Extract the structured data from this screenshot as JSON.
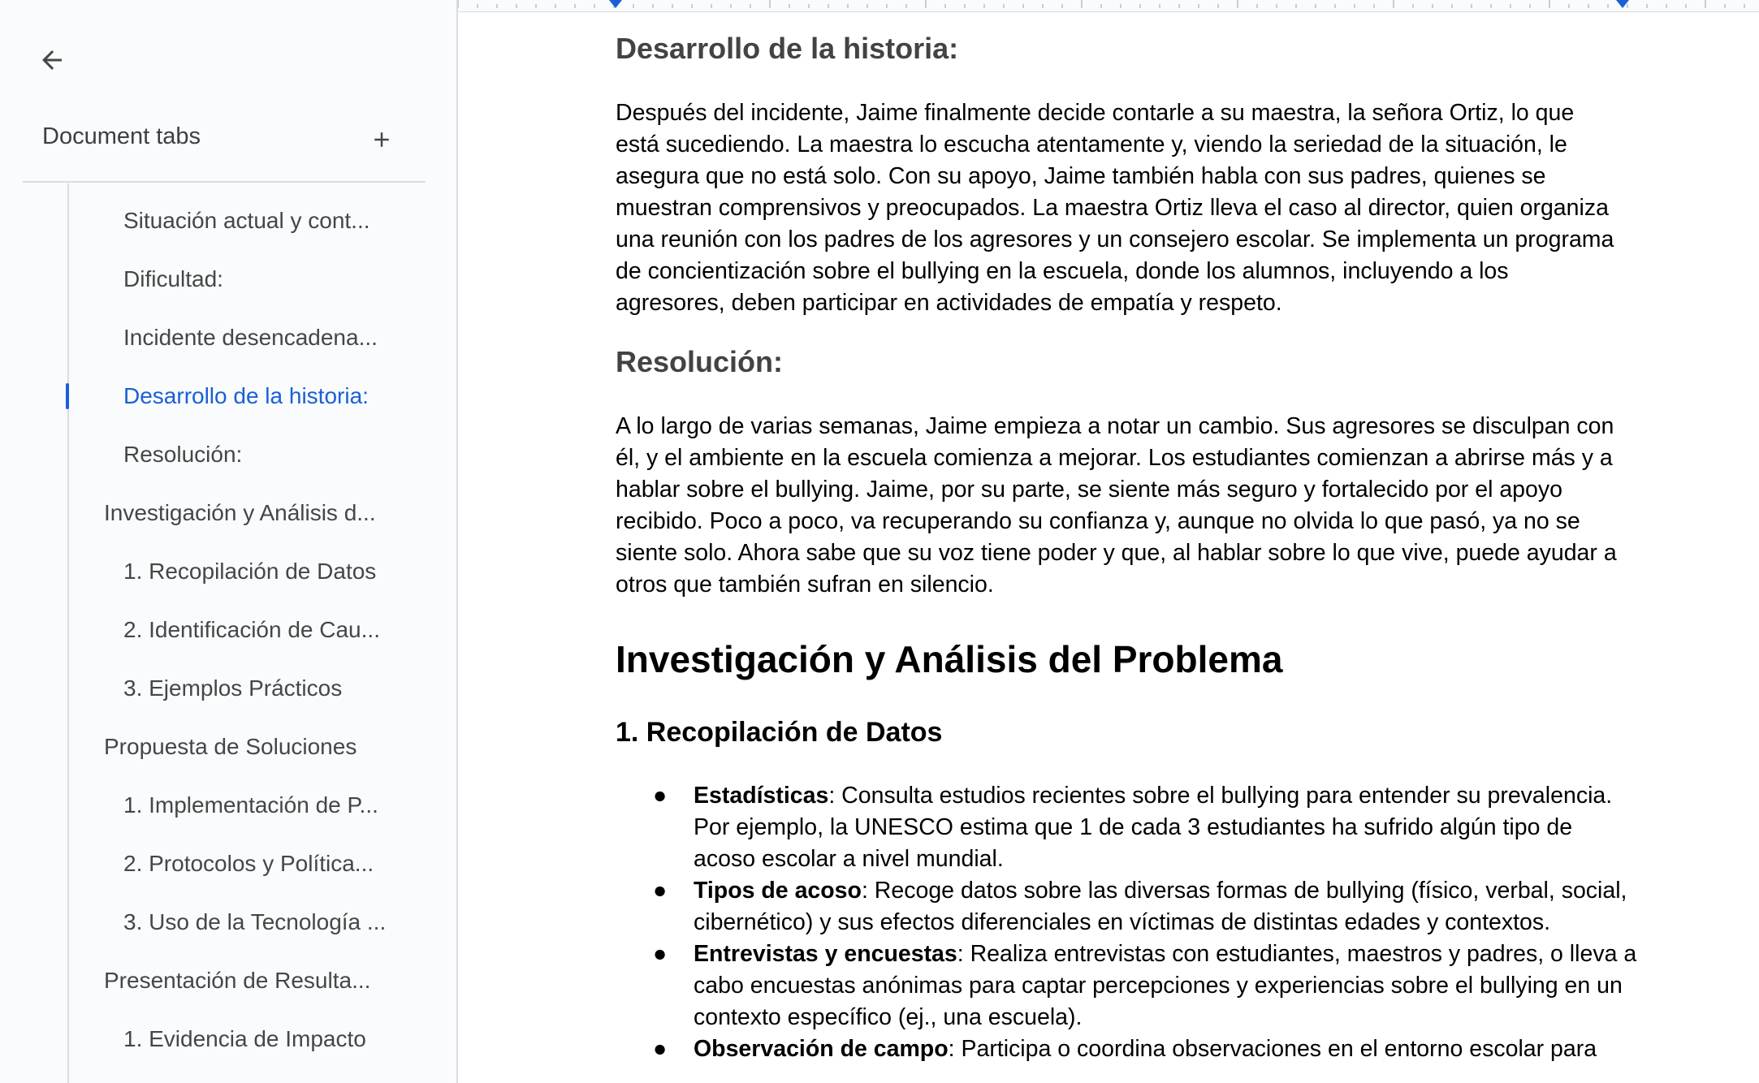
{
  "sidebar": {
    "header": "Document tabs",
    "items": [
      {
        "label": "Situación actual y cont...",
        "level": 2,
        "active": false
      },
      {
        "label": "Dificultad:",
        "level": 2,
        "active": false
      },
      {
        "label": "Incidente desencadena...",
        "level": 2,
        "active": false
      },
      {
        "label": "Desarrollo de la historia:",
        "level": 2,
        "active": true
      },
      {
        "label": "Resolución:",
        "level": 2,
        "active": false
      },
      {
        "label": "Investigación y Análisis d...",
        "level": 1,
        "active": false
      },
      {
        "label": "1. Recopilación de Datos",
        "level": 2,
        "active": false
      },
      {
        "label": "2. Identificación de Cau...",
        "level": 2,
        "active": false
      },
      {
        "label": "3. Ejemplos Prácticos",
        "level": 2,
        "active": false
      },
      {
        "label": "Propuesta de Soluciones",
        "level": 1,
        "active": false
      },
      {
        "label": "1. Implementación de P...",
        "level": 2,
        "active": false
      },
      {
        "label": "2. Protocolos y Política...",
        "level": 2,
        "active": false
      },
      {
        "label": "3. Uso de la Tecnología ...",
        "level": 2,
        "active": false
      },
      {
        "label": "Presentación de Resulta...",
        "level": 1,
        "active": false
      },
      {
        "label": "1. Evidencia de Impacto",
        "level": 2,
        "active": false
      }
    ],
    "back_icon": "arrow-left-icon",
    "add_icon": "plus-icon"
  },
  "document": {
    "h_desarrollo": "Desarrollo de la historia:",
    "p_desarrollo": "Después del incidente, Jaime finalmente decide contarle a su maestra, la señora Ortiz, lo que está sucediendo. La maestra lo escucha atentamente y, viendo la seriedad de la situación, le asegura que no está solo. Con su apoyo, Jaime también habla con sus padres, quienes se muestran comprensivos y preocupados. La maestra Ortiz lleva el caso al director, quien organiza una reunión con los padres de los agresores y un consejero escolar. Se implementa un programa de concientización sobre el bullying en la escuela, donde los alumnos, incluyendo a los agresores, deben participar en actividades de empatía y respeto.",
    "h_resolucion": "Resolución:",
    "p_resolucion": "A lo largo de varias semanas, Jaime empieza a notar un cambio. Sus agresores se disculpan con él, y el ambiente en la escuela comienza a mejorar. Los estudiantes comienzan a abrirse más y a hablar sobre el bullying. Jaime, por su parte, se siente más seguro y fortalecido por el apoyo recibido. Poco a poco, va recuperando su confianza y, aunque no olvida lo que pasó, ya no se siente solo. Ahora sabe que su voz tiene poder y que, al hablar sobre lo que vive, puede ayudar a otros que también sufran en silencio.",
    "h1_investigacion": "Investigación y Análisis del Problema",
    "h2_recopilacion": "1. Recopilación de Datos",
    "bullets": [
      {
        "term": "Estadísticas",
        "text": ": Consulta estudios recientes sobre el bullying para entender su prevalencia. Por ejemplo, la UNESCO estima que 1 de cada 3 estudiantes ha sufrido algún tipo de acoso escolar a nivel mundial."
      },
      {
        "term": "Tipos de acoso",
        "text": ": Recoge datos sobre las diversas formas de bullying (físico, verbal, social, cibernético) y sus efectos diferenciales en víctimas de distintas edades y contextos."
      },
      {
        "term": "Entrevistas y encuestas",
        "text": ": Realiza entrevistas con estudiantes, maestros y padres, o lleva a cabo encuestas anónimas para captar percepciones y experiencias sobre el bullying en un contexto específico (ej., una escuela)."
      },
      {
        "term": "Observación de campo",
        "text": ": Participa o coordina observaciones en el entorno escolar para"
      }
    ],
    "bullet_char": "●"
  },
  "colors": {
    "accent": "#1a5fd6",
    "sidebar_bg": "#f9fbfd",
    "text_gray": "#444746",
    "heading_gray": "#434343"
  }
}
